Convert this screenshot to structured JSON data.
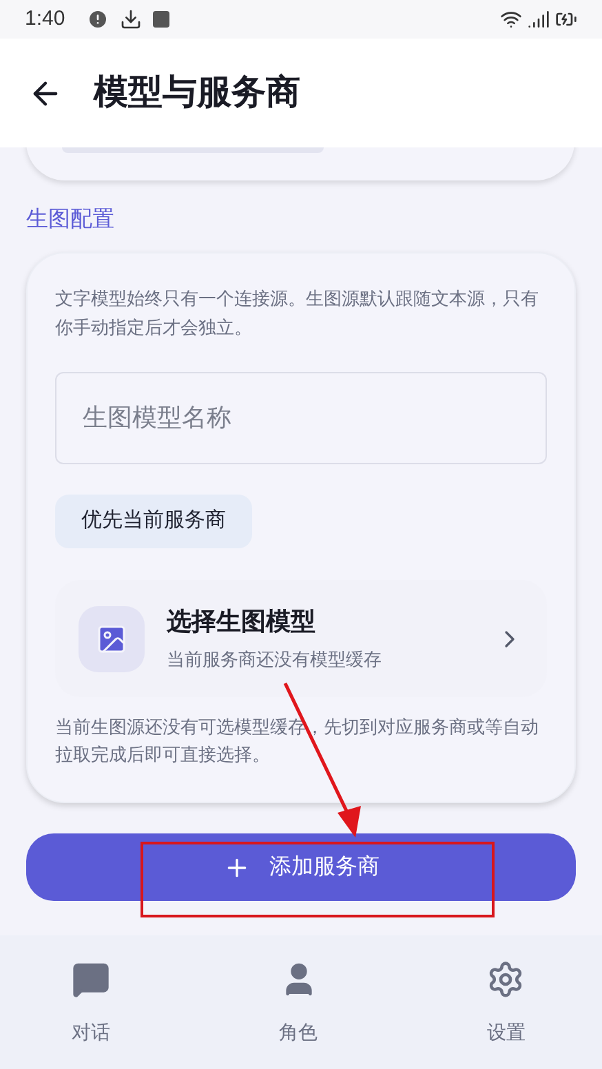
{
  "status_bar": {
    "time": "1:40"
  },
  "header": {
    "title": "模型与服务商"
  },
  "section": {
    "title": "生图配置"
  },
  "card": {
    "description": "文字模型始终只有一个连接源。生图源默认跟随文本源，只有你手动指定后才会独立。",
    "model_field": {
      "placeholder": "生图模型名称"
    },
    "chip": {
      "label": "优先当前服务商"
    },
    "picker": {
      "title": "选择生图模型",
      "subtitle": "当前服务商还没有模型缓存"
    },
    "note": "当前生图源还没有可选模型缓存，先切到对应服务商或等自动拉取完成后即可直接选择。"
  },
  "add_button": {
    "label": "添加服务商"
  },
  "nav": [
    {
      "label": "对话",
      "kind": "chat",
      "selected": false
    },
    {
      "label": "角色",
      "kind": "person",
      "selected": false
    },
    {
      "label": "设置",
      "kind": "gear",
      "selected": false
    }
  ]
}
